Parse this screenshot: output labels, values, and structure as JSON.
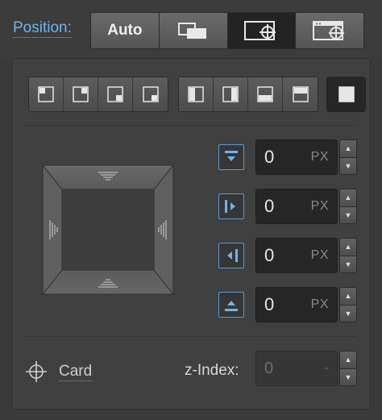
{
  "header": {
    "position_label": "Position:",
    "modes": [
      {
        "label": "Auto",
        "icon": "text",
        "active": false
      },
      {
        "label": "",
        "icon": "relative-position-icon",
        "active": false
      },
      {
        "label": "",
        "icon": "absolute-position-icon",
        "active": true
      },
      {
        "label": "",
        "icon": "fixed-position-icon",
        "active": false
      }
    ]
  },
  "presets": {
    "corners": [
      "top-left-preset-icon",
      "top-right-preset-icon",
      "bottom-right-preset-icon",
      "bottom-left-preset-icon"
    ],
    "sides": [
      "left-preset-icon",
      "right-preset-icon",
      "bottom-preset-icon",
      "top-preset-icon"
    ],
    "full": "full-preset-icon"
  },
  "offsets": {
    "top": {
      "value": "0",
      "unit": "PX"
    },
    "left": {
      "value": "0",
      "unit": "PX"
    },
    "right": {
      "value": "0",
      "unit": "PX"
    },
    "bottom": {
      "value": "0",
      "unit": "PX"
    }
  },
  "footer": {
    "relative_to": "Card",
    "zindex_label": "z-Index:",
    "zindex_value": "0",
    "zindex_unit": "-"
  },
  "colors": {
    "accent": "#6fb3ef",
    "panel": "#404040",
    "background": "#3a3a3a",
    "field": "#262626"
  }
}
